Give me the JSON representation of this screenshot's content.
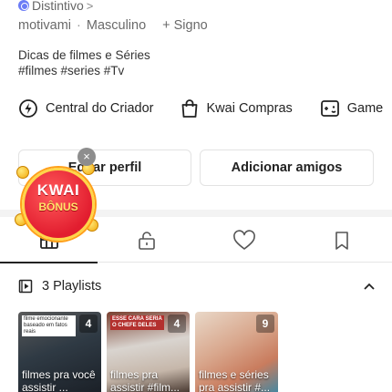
{
  "profile": {
    "badge_label": "Distintivo",
    "badge_chevron": ">",
    "username": "motivami",
    "separator": "·",
    "gender": "Masculino",
    "sign_plus": "+",
    "sign_label": "Signo",
    "bio_line1": "Dicas de filmes e Séries",
    "bio_line2": "#filmes #series #Tv"
  },
  "quicklinks": [
    {
      "label": "Central do Criador",
      "icon": "lightning-circle-icon"
    },
    {
      "label": "Kwai Compras",
      "icon": "shopping-bag-icon"
    },
    {
      "label": "Game",
      "icon": "gamepad-icon"
    }
  ],
  "buttons": {
    "edit_profile": "Editar perfil",
    "add_friends": "Adicionar amigos"
  },
  "kwai_bonus": {
    "title": "KWAI",
    "subtitle": "BÔNUS",
    "close": "×"
  },
  "tabs": [
    {
      "icon": "grid-icon",
      "active": true
    },
    {
      "icon": "lock-icon",
      "active": false
    },
    {
      "icon": "heart-icon",
      "active": false
    },
    {
      "icon": "bookmark-icon",
      "active": false
    }
  ],
  "playlists": {
    "title": "3 Playlists",
    "items": [
      {
        "count": "4",
        "caption": "filmes pra você assistir ...",
        "overlay": "filme emocionante baseado em fatos reais"
      },
      {
        "count": "4",
        "caption": "filmes pra assistir #film...",
        "overlay": "ESSE CARA SERIA O CHEFE DELES"
      },
      {
        "count": "9",
        "caption": "filmes e séries pra assistir #...",
        "overlay": ""
      }
    ]
  },
  "colors": {
    "accent_badge": "#6b7cf6",
    "kwai_red": "#e21d2f",
    "kwai_gold": "#ffd54a"
  }
}
